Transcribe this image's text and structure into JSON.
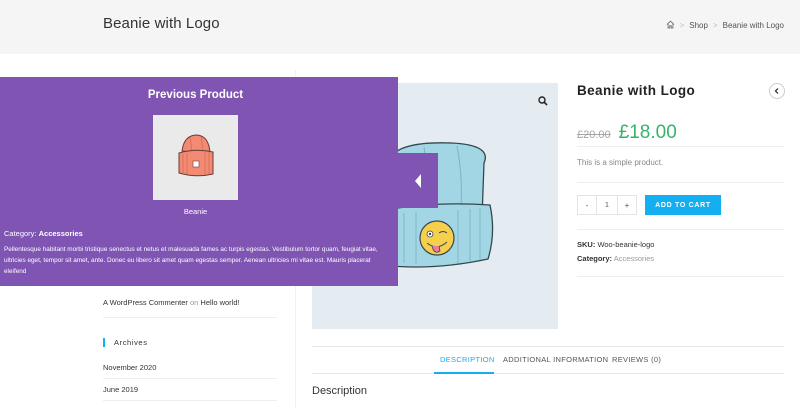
{
  "header": {
    "title": "Beanie with Logo",
    "breadcrumb": {
      "home_icon": "home-icon",
      "separator": ">",
      "shop": "Shop",
      "current": "Beanie with Logo"
    }
  },
  "sidebar": {
    "recent_comment": {
      "author": "A WordPress Commenter",
      "on": "on",
      "post": "Hello world!"
    },
    "archives_title": "Archives",
    "archives": [
      "November 2020",
      "June 2019"
    ]
  },
  "product": {
    "name": "Beanie with Logo",
    "price_old": "£20.00",
    "price_new": "£18.00",
    "short_description": "This is a simple product.",
    "quantity": "1",
    "minus": "-",
    "plus": "+",
    "add_to_cart": "ADD TO CART",
    "sku_label": "SKU:",
    "sku": "Woo-beanie-logo",
    "category_label": "Category:",
    "category": "Accessories",
    "nav_prev_icon": "chevron-left-icon",
    "zoom_icon": "search-icon"
  },
  "tabs": {
    "items": [
      "DESCRIPTION",
      "ADDITIONAL INFORMATION",
      "REVIEWS (0)"
    ],
    "active": 0
  },
  "description_heading": "Description",
  "prev_product": {
    "panel_title": "Previous Product",
    "name": "Beanie",
    "category_label": "Category:",
    "category": "Accessories",
    "text": "Pellentesque habitant morbi tristique senectus et netus et malesuada fames ac turpis egestas. Vestibulum tortor quam, feugiat vitae, ultricies eget, tempor sit amet, ante. Donec eu libero sit amet quam egestas semper. Aenean ultricies mi vitae est. Mauris placerat eleifend",
    "arrow_icon": "caret-left-icon"
  },
  "colors": {
    "accent": "#13aff0",
    "price": "#36b36a",
    "panel": "#7f54b3",
    "header_bg": "#f5f5f5"
  }
}
